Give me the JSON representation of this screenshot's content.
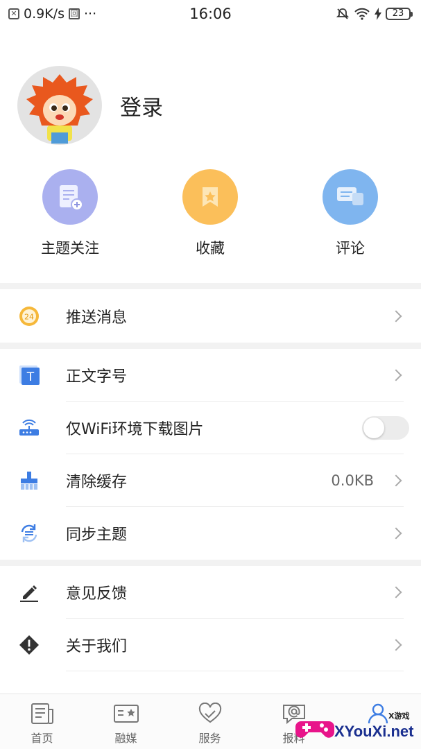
{
  "status_bar": {
    "speed": "0.9K/s",
    "dots": "···",
    "time": "16:06",
    "battery": "23"
  },
  "profile": {
    "login_label": "登录"
  },
  "quick_actions": [
    {
      "label": "主题关注",
      "icon": "document-add-icon",
      "color": "#aab0ef"
    },
    {
      "label": "收藏",
      "icon": "bookmark-star-icon",
      "color": "#fbbf5a"
    },
    {
      "label": "评论",
      "icon": "chat-bubbles-icon",
      "color": "#7fb5ef"
    }
  ],
  "settings": {
    "push": {
      "label": "推送消息",
      "icon": "24-badge-icon"
    },
    "font_size": {
      "label": "正文字号",
      "icon": "text-size-icon"
    },
    "wifi_only": {
      "label": "仅WiFi环境下载图片",
      "icon": "router-icon",
      "enabled": false
    },
    "clear_cache": {
      "label": "清除缓存",
      "value": "0.0KB",
      "icon": "brush-icon"
    },
    "sync": {
      "label": "同步主题",
      "icon": "sync-icon"
    },
    "feedback": {
      "label": "意见反馈",
      "icon": "pencil-icon"
    },
    "about": {
      "label": "关于我们",
      "icon": "warning-diamond-icon"
    }
  },
  "bottom_nav": [
    {
      "label": "首页",
      "icon": "home-doc-icon"
    },
    {
      "label": "融媒",
      "icon": "media-star-icon"
    },
    {
      "label": "服务",
      "icon": "heart-hands-icon"
    },
    {
      "label": "报料",
      "icon": "at-bubble-icon"
    },
    {
      "label": "",
      "icon": "user-icon"
    }
  ],
  "watermark": {
    "text": "XYouXi.net",
    "small": "X游戏"
  }
}
